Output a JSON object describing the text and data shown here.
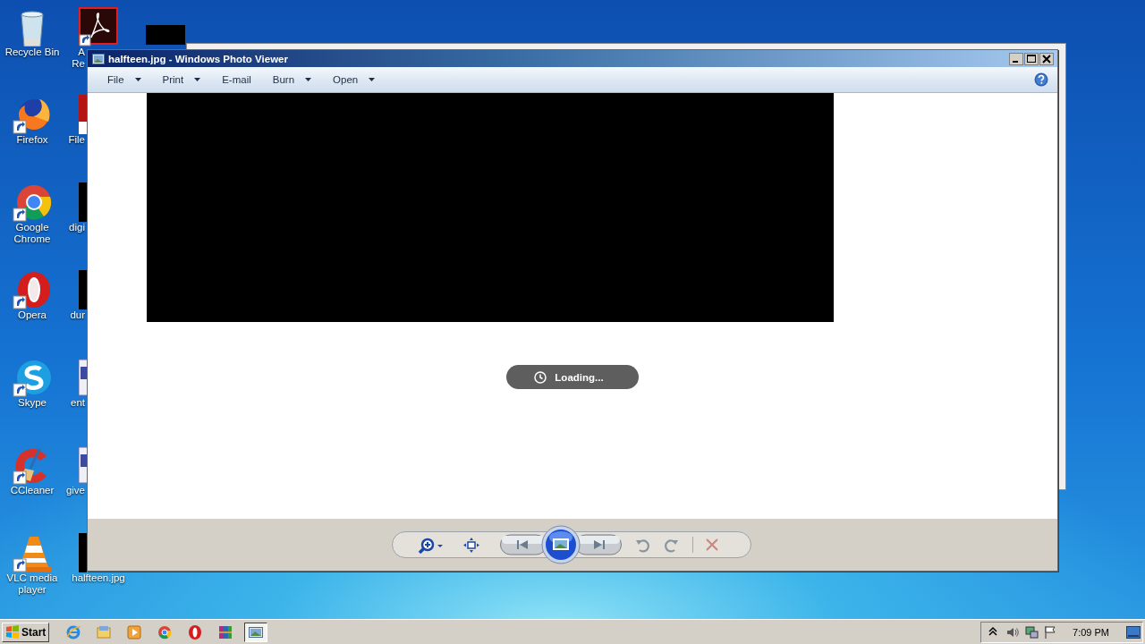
{
  "desktop": {
    "columns": [
      {
        "icons": [
          {
            "kind": "recycle",
            "lines": [
              "Recycle Bin"
            ]
          },
          {
            "kind": "firefox",
            "lines": [
              "Firefox"
            ]
          },
          {
            "kind": "chrome",
            "lines": [
              "Google",
              "Chrome"
            ]
          },
          {
            "kind": "opera",
            "lines": [
              "Opera"
            ]
          },
          {
            "kind": "skype",
            "lines": [
              "Skype"
            ]
          },
          {
            "kind": "ccleaner",
            "lines": [
              "CCleaner"
            ]
          },
          {
            "kind": "vlc",
            "lines": [
              "VLC media",
              "player"
            ]
          }
        ]
      },
      {
        "icons": [
          {
            "kind": "acrobat",
            "lines": [
              "A",
              "Re"
            ]
          },
          {
            "kind": "redfile",
            "lines": [
              "File"
            ]
          },
          {
            "kind": "dark",
            "lines": [
              "digi"
            ]
          },
          {
            "kind": "dark",
            "lines": [
              "dur"
            ]
          },
          {
            "kind": "document",
            "lines": [
              "ent"
            ]
          },
          {
            "kind": "document",
            "lines": [
              "give"
            ]
          },
          {
            "kind": "dark",
            "lines": [
              "halfteen.jpg"
            ]
          }
        ]
      },
      {
        "icons": [
          {
            "kind": "dark"
          }
        ]
      }
    ]
  },
  "window": {
    "title": "halfteen.jpg - Windows Photo Viewer",
    "menu": [
      {
        "label": "File",
        "dropdown": true
      },
      {
        "label": "Print",
        "dropdown": true
      },
      {
        "label": "E-mail",
        "dropdown": false
      },
      {
        "label": "Burn",
        "dropdown": true
      },
      {
        "label": "Open",
        "dropdown": true
      }
    ],
    "status": "Loading...",
    "controls": [
      {
        "kind": "zoom"
      },
      {
        "kind": "fit"
      },
      {
        "kind": "previous"
      },
      {
        "kind": "slideshow"
      },
      {
        "kind": "next"
      },
      {
        "kind": "rotate-left"
      },
      {
        "kind": "rotate-right"
      },
      {
        "kind": "delete"
      }
    ]
  },
  "taskbar": {
    "start": "Start",
    "apps": [
      {
        "kind": "ie",
        "selected": false
      },
      {
        "kind": "explorer",
        "selected": false
      },
      {
        "kind": "media",
        "selected": false
      },
      {
        "kind": "chrome",
        "selected": false
      },
      {
        "kind": "opera",
        "selected": false
      },
      {
        "kind": "winrar",
        "selected": false
      },
      {
        "kind": "photos",
        "selected": true
      }
    ],
    "clock": "7:09 PM"
  }
}
